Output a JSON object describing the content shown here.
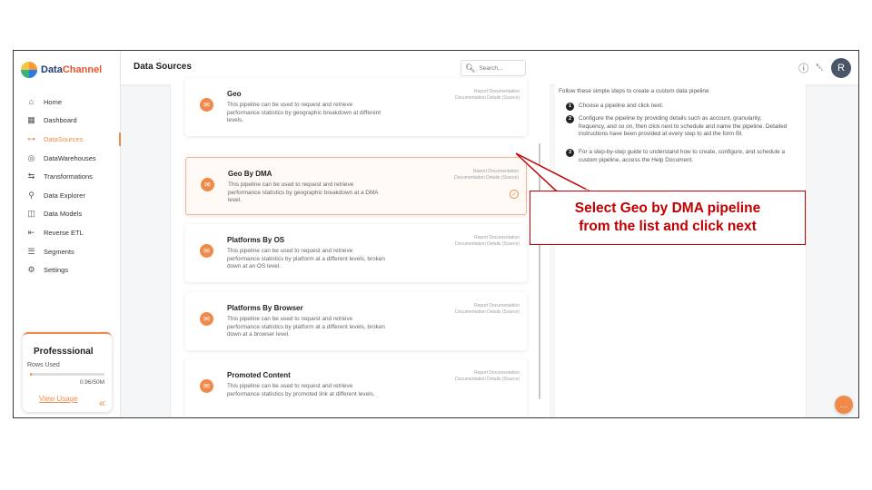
{
  "brand": {
    "name_part1": "Data",
    "name_part2": "Channel"
  },
  "sidebar": {
    "items": [
      {
        "label": "Home",
        "icon": "home-icon",
        "glyph": "⌂"
      },
      {
        "label": "Dashboard",
        "icon": "dashboard-icon",
        "glyph": "▦"
      },
      {
        "label": "DataSources",
        "icon": "datasources-icon",
        "glyph": "⊶"
      },
      {
        "label": "DataWarehouses",
        "icon": "warehouse-icon",
        "glyph": "◎"
      },
      {
        "label": "Transformations",
        "icon": "transform-icon",
        "glyph": "⇆"
      },
      {
        "label": "Data Explorer",
        "icon": "explorer-icon",
        "glyph": "⚲"
      },
      {
        "label": "Data Models",
        "icon": "models-icon",
        "glyph": "◫"
      },
      {
        "label": "Reverse ETL",
        "icon": "reverse-etl-icon",
        "glyph": "⇤"
      },
      {
        "label": "Segments",
        "icon": "segments-icon",
        "glyph": "☰"
      },
      {
        "label": "Settings",
        "icon": "gear-icon",
        "glyph": "⚙"
      }
    ],
    "active_index": 2,
    "plan": {
      "title": "Professsional",
      "rows_label": "Rows Used",
      "usage_value": "0.96/50M",
      "usage_fraction": 0.019,
      "link_label": "View Usage"
    },
    "collapse_glyph": "«"
  },
  "header": {
    "title": "Data Sources",
    "search_placeholder": "Search...",
    "avatar_initial": "R"
  },
  "pipelines": [
    {
      "title": "Geo",
      "description": "This pipeline can be used to request and retrieve performance statistics by geographic breakdown at different levels.",
      "link1": "Report Documentation",
      "link2": "Documentation Details (Source)",
      "selected": false
    },
    {
      "title": "Geo By DMA",
      "description": "This pipeline can be used to request and retrieve performance statistics by geographic breakdown at a DMA level.",
      "link1": "Report Documentation",
      "link2": "Documentation Details (Source)",
      "selected": true
    },
    {
      "title": "Platforms By OS",
      "description": "This pipeline can be used to request and retrieve performance statistics by platform at a different levels, broken down at an OS level.",
      "link1": "Report Documentation",
      "link2": "Documentation Details (Source)",
      "selected": false
    },
    {
      "title": "Platforms By Browser",
      "description": "This pipeline can be used to request and retrieve performance statistics by platform at a different levels, broken down at a browser level.",
      "link1": "Report Documentation",
      "link2": "Documentation Details (Source)",
      "selected": false
    },
    {
      "title": "Promoted Content",
      "description": "This pipeline can be used to request and retrieve performance statistics by promoted link at different levels.",
      "link1": "Report Documentation",
      "link2": "Documentation Details (Source)",
      "selected": false
    }
  ],
  "instructions": {
    "intro": "Follow these simple steps to create a custom data pipeline",
    "steps": [
      {
        "num": "1",
        "text": "Choose a pipeline and click next."
      },
      {
        "num": "2",
        "text": "Configure the pipeline by providing details such as account, granularity, frequency, and so on, then click next to schedule and name the pipeline. Detailed instructions have been provided at every step to aid the form fill."
      },
      {
        "num": "3",
        "text": "For a step-by-step guide to understand how to create, configure, and schedule a custom pipeline, access the Help Document."
      }
    ]
  },
  "callout": {
    "line1": "Select Geo by DMA pipeline",
    "line2": "from the list and click next",
    "color": "#c00000"
  },
  "colors": {
    "accent": "#f08a4b",
    "brand_dark": "#1f3b73",
    "brand_orange": "#e8542a"
  }
}
